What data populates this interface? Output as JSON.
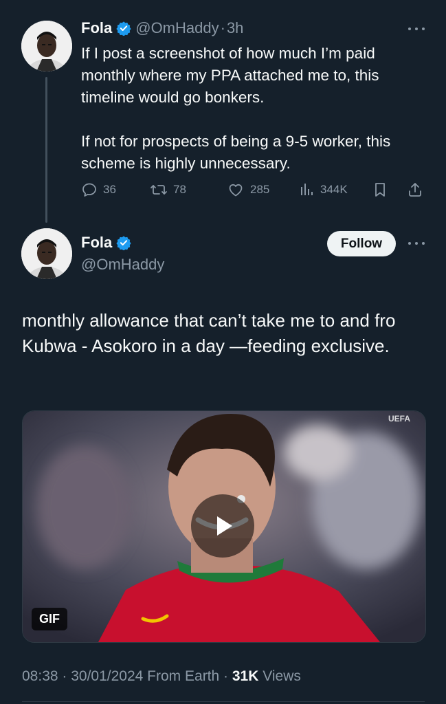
{
  "parent_tweet": {
    "name": "Fola",
    "handle": "@OmHaddy",
    "separator": "·",
    "time": "3h",
    "paragraph1": "If I post a screenshot of how much I’m paid monthly where my PPA attached me to, this timeline would go bonkers.",
    "paragraph2": "If not for prospects of being a 9-5 worker, this scheme is highly unnecessary.",
    "replies": "36",
    "retweets": "78",
    "likes": "285",
    "views": "344K"
  },
  "main_tweet": {
    "name": "Fola",
    "handle": "@OmHaddy",
    "follow_label": "Follow",
    "text": "monthly allowance that can’t take me to and fro Kubwa - Asokoro in a day —feeding exclusive.",
    "media": {
      "badge": "GIF",
      "watermark": "UEFA"
    },
    "meta": {
      "time": "08:38",
      "sep1": " · ",
      "date": "30/01/2024",
      "source": " From Earth",
      "sep2": " · ",
      "views_count": "31K",
      "views_label": " Views"
    }
  },
  "colors": {
    "background": "#15202b",
    "text": "#f7f9f9",
    "secondary": "#8b98a5",
    "verified": "#1d9bf0",
    "jersey": "#c8102e"
  },
  "icons": [
    "verified-badge-icon",
    "more-icon",
    "reply-icon",
    "retweet-icon",
    "like-icon",
    "views-icon",
    "bookmark-icon",
    "share-icon",
    "play-icon"
  ]
}
